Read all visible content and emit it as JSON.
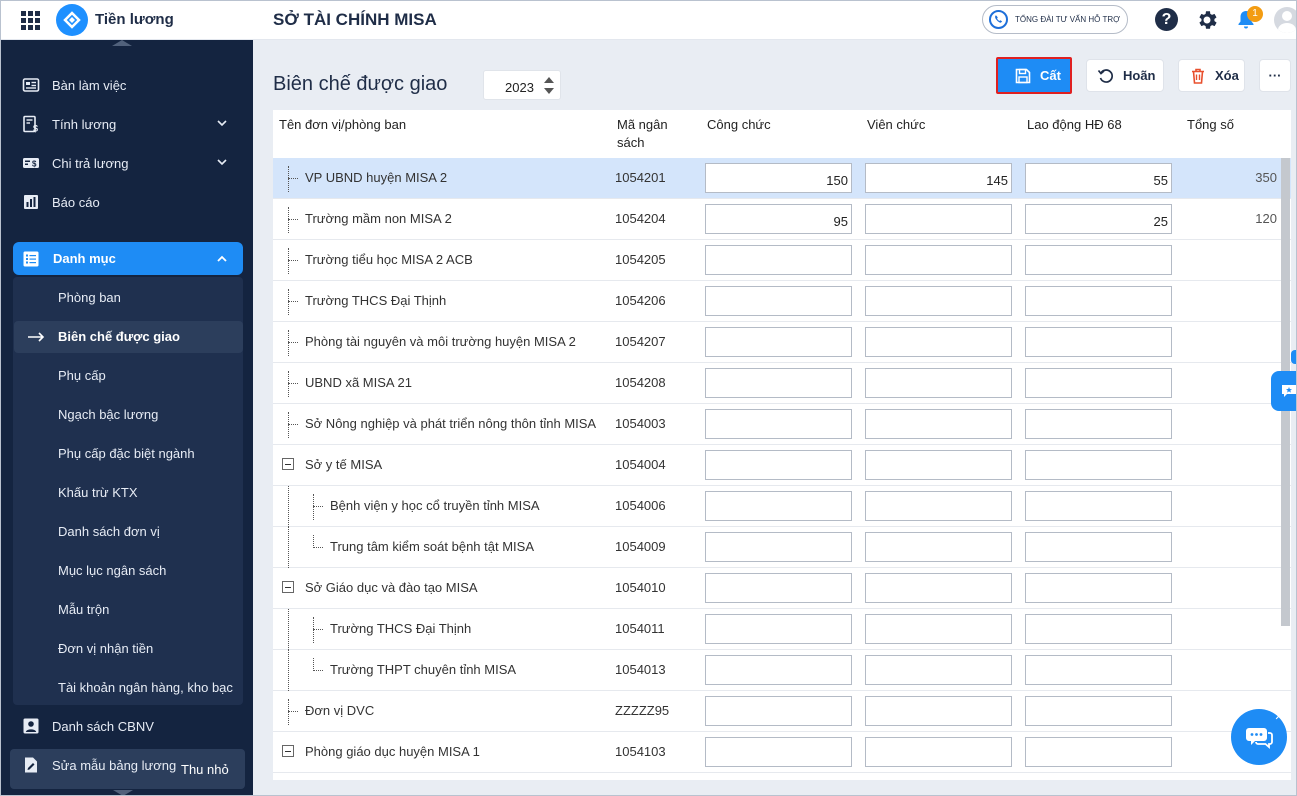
{
  "header": {
    "app_name": "Tiền lương",
    "org_name": "SỞ TÀI CHÍNH MISA",
    "support_label": "TỔNG ĐÀI TƯ VẤN HỖ TRỢ",
    "notification_count": "1",
    "help_label": "?"
  },
  "sidebar": {
    "items": [
      {
        "label": "Bàn làm việc",
        "icon": "dashboard-icon"
      },
      {
        "label": "Tính lương",
        "icon": "payroll-icon"
      },
      {
        "label": "Chi trả lương",
        "icon": "payment-icon"
      },
      {
        "label": "Báo cáo",
        "icon": "report-icon"
      }
    ],
    "active_group": "Danh mục",
    "sub_items": [
      "Phòng ban",
      "Biên chế được giao",
      "Phụ cấp",
      "Ngạch bậc lương",
      "Phụ cấp đặc biệt ngành",
      "Khấu trừ KTX",
      "Danh sách đơn vị",
      "Mục lục ngân sách",
      "Mẫu trộn",
      "Đơn vị nhận tiền",
      "Tài khoản ngân hàng, kho bạc"
    ],
    "after_items": [
      {
        "label": "Danh sách CBNV",
        "icon": "employee-icon"
      },
      {
        "label": "Sửa mẫu bảng lương",
        "icon": "edit-template-icon"
      }
    ],
    "collapse_label": "Thu nhỏ"
  },
  "page": {
    "title": "Biên chế được giao",
    "year": "2023",
    "save_label": "Cất",
    "undo_label": "Hoãn",
    "delete_label": "Xóa",
    "more_label": "···"
  },
  "table": {
    "headers": {
      "name": "Tên đơn vị/phòng ban",
      "code_line1": "Mã ngân",
      "code_line2": "sách",
      "cong_chuc": "Công chức",
      "vien_chuc": "Viên chức",
      "lao_dong": "Lao động HĐ 68",
      "tong_so": "Tổng số"
    },
    "rows": [
      {
        "name": "VP UBND huyện MISA 2",
        "code": "1054201",
        "cong_chuc": "150",
        "vien_chuc": "145",
        "lao_dong": "55",
        "total": "350"
      },
      {
        "name": "Trường mầm non MISA 2",
        "code": "1054204",
        "cong_chuc": "95",
        "vien_chuc": "",
        "lao_dong": "25",
        "total": "120"
      },
      {
        "name": "Trường tiểu học MISA 2 ACB",
        "code": "1054205",
        "cong_chuc": "",
        "vien_chuc": "",
        "lao_dong": "",
        "total": ""
      },
      {
        "name": "Trường THCS Đại Thịnh",
        "code": "1054206",
        "cong_chuc": "",
        "vien_chuc": "",
        "lao_dong": "",
        "total": ""
      },
      {
        "name": "Phòng tài nguyên và môi trường huyện MISA 2",
        "code": "1054207",
        "cong_chuc": "",
        "vien_chuc": "",
        "lao_dong": "",
        "total": ""
      },
      {
        "name": "UBND xã MISA 21",
        "code": "1054208",
        "cong_chuc": "",
        "vien_chuc": "",
        "lao_dong": "",
        "total": ""
      },
      {
        "name": "Sở Nông nghiệp và phát triển nông thôn tỉnh MISA",
        "code": "1054003",
        "cong_chuc": "",
        "vien_chuc": "",
        "lao_dong": "",
        "total": ""
      },
      {
        "name": "Sở y tế MISA",
        "code": "1054004",
        "cong_chuc": "",
        "vien_chuc": "",
        "lao_dong": "",
        "total": ""
      },
      {
        "name": "Bệnh viện y học cổ truyền tỉnh MISA",
        "code": "1054006",
        "cong_chuc": "",
        "vien_chuc": "",
        "lao_dong": "",
        "total": ""
      },
      {
        "name": "Trung tâm kiểm soát bệnh tật MISA",
        "code": "1054009",
        "cong_chuc": "",
        "vien_chuc": "",
        "lao_dong": "",
        "total": ""
      },
      {
        "name": "Sở Giáo dục và đào tạo MISA",
        "code": "1054010",
        "cong_chuc": "",
        "vien_chuc": "",
        "lao_dong": "",
        "total": ""
      },
      {
        "name": "Trường THCS Đại Thịnh",
        "code": "1054011",
        "cong_chuc": "",
        "vien_chuc": "",
        "lao_dong": "",
        "total": ""
      },
      {
        "name": "Trường THPT chuyên tỉnh MISA",
        "code": "1054013",
        "cong_chuc": "",
        "vien_chuc": "",
        "lao_dong": "",
        "total": ""
      },
      {
        "name": "Đơn vị DVC",
        "code": "ZZZZZ95",
        "cong_chuc": "",
        "vien_chuc": "",
        "lao_dong": "",
        "total": ""
      },
      {
        "name": "Phòng giáo dục huyện MISA 1",
        "code": "1054103",
        "cong_chuc": "",
        "vien_chuc": "",
        "lao_dong": "",
        "total": ""
      }
    ]
  },
  "colors": {
    "sidebar_bg": "#142440",
    "accent": "#1e8cf5",
    "row_highlight": "#d4e5fb",
    "save_outline": "#e02020"
  }
}
